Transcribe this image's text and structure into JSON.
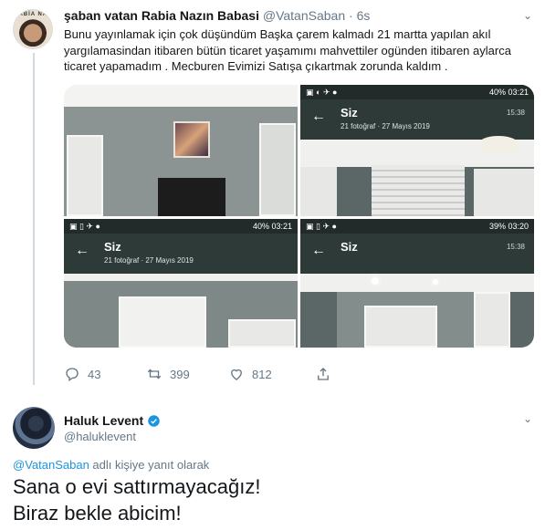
{
  "tweet1": {
    "display_name": "şaban vatan Rabia Nazın Babasi",
    "handle": "@VatanSaban",
    "separator": "·",
    "time": "6s",
    "avatar_text": "RABİA NAZ",
    "text": "Bunu yayınlamak için çok düşündüm Başka çarem kalmadı 21 martta yapılan akıl yargılamasindan itibaren bütün ticaret yaşamımı mahvettiler ogünden itibaren aylarca ticaret yapamadım . Mecburen Evimizi Satışa çıkartmak zorunda kaldım .",
    "photos": [
      {
        "status_time": "",
        "chat_title": "",
        "chat_sub": "",
        "chat_time": ""
      },
      {
        "status_right": "40% 03:21",
        "chat_title": "Siz",
        "chat_sub": "21 fotoğraf · 27 Mayıs 2019",
        "chat_time": "15:38"
      },
      {
        "status_right": "40% 03:21",
        "chat_title": "Siz",
        "chat_sub": "21 fotoğraf · 27 Mayıs 2019",
        "chat_time": ""
      },
      {
        "status_right": "39% 03:20",
        "chat_title": "Siz",
        "chat_sub": "",
        "chat_time": "15:38"
      }
    ],
    "actions": {
      "reply_count": "43",
      "retweet_count": "399",
      "like_count": "812"
    }
  },
  "tweet2": {
    "display_name": "Haluk Levent",
    "handle": "@haluklevent",
    "reply_mention": "@VatanSaban",
    "reply_suffix": " adlı kişiye yanıt olarak",
    "line1": "Sana o evi sattırmayacağız!",
    "line2": "Biraz bekle abicim!"
  },
  "colors": {
    "accent": "#1b95e0",
    "secondary_text": "#657786",
    "thread_line": "#cfd9de"
  }
}
